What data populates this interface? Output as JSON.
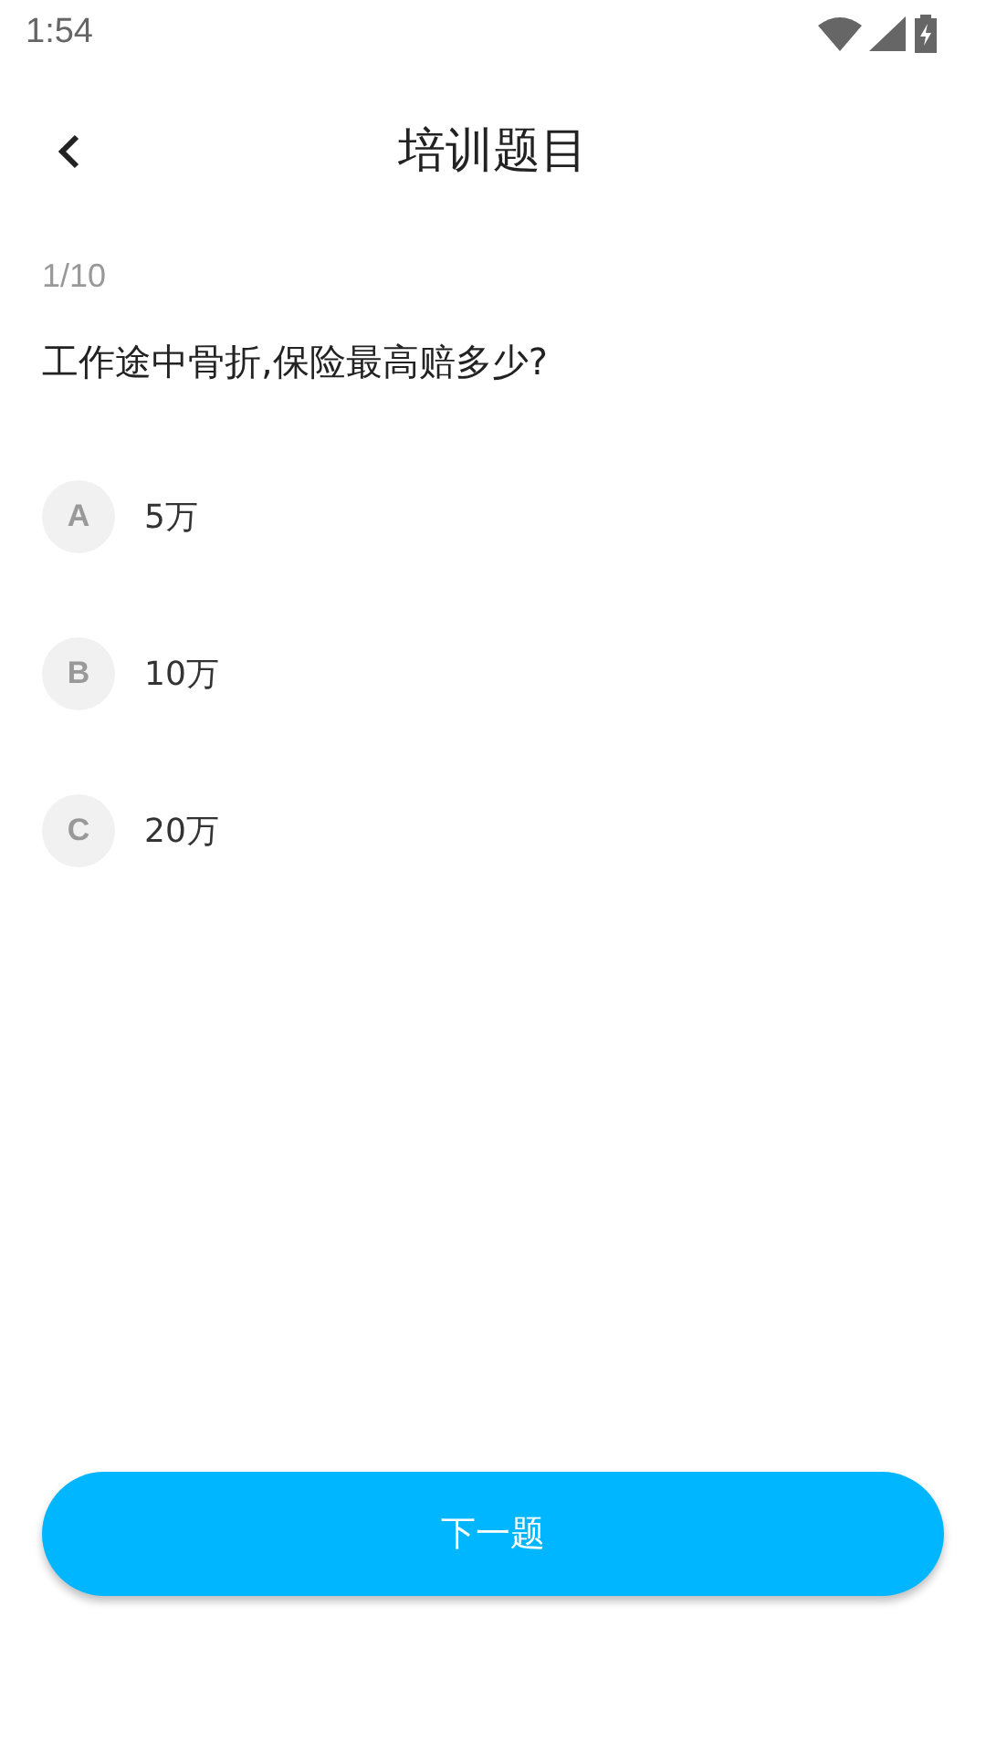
{
  "status_bar": {
    "time": "1:54"
  },
  "header": {
    "title": "培训题目"
  },
  "progress": "1/10",
  "question": "工作途中骨折,保险最高赔多少?",
  "options": [
    {
      "letter": "A",
      "text": "5万"
    },
    {
      "letter": "B",
      "text": "10万"
    },
    {
      "letter": "C",
      "text": "20万"
    }
  ],
  "next_button": "下一题"
}
